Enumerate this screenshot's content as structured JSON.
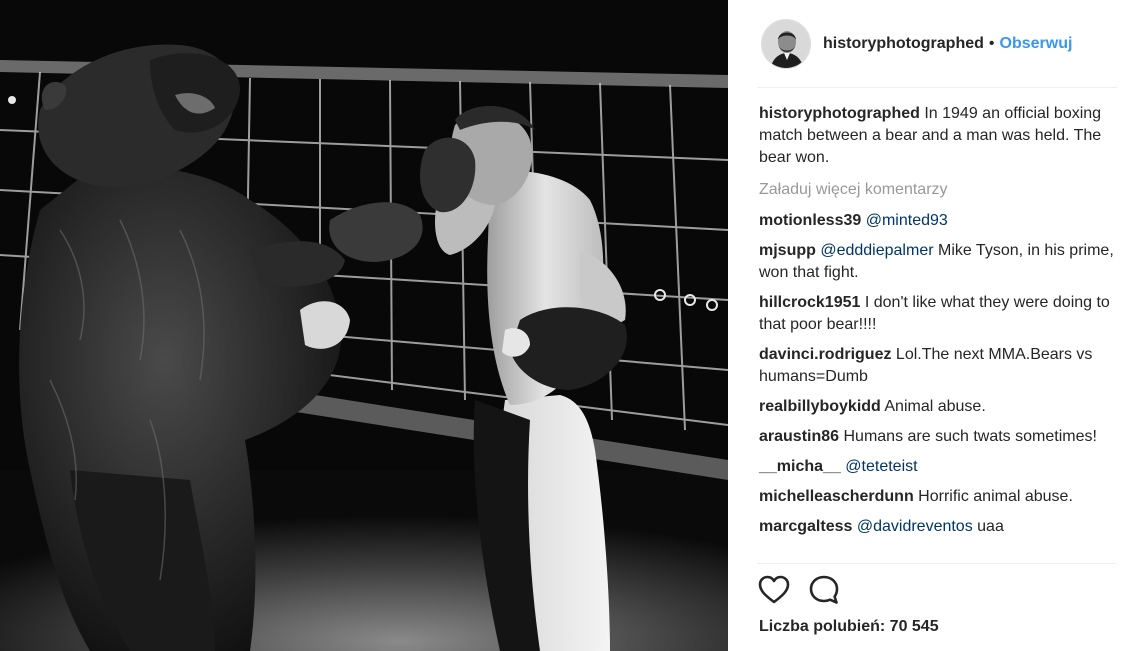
{
  "post": {
    "author": "historyphotographed",
    "separator": "•",
    "follow_label": "Obserwuj",
    "caption_author": "historyphotographed",
    "caption_text": " In 1949 an official boxing match between a bear and a man was held. The bear won.",
    "load_more_label": "Załaduj więcej komentarzy",
    "likes_text": "Liczba polubień: 70 545"
  },
  "comments": [
    {
      "user": "motionless39",
      "mention": "@minted93",
      "text": ""
    },
    {
      "user": "mjsupp",
      "mention": "@edddiepalmer",
      "text": " Mike Tyson, in his prime, won that fight."
    },
    {
      "user": "hillcrock1951",
      "mention": "",
      "text": " I don't like what they were doing to that poor bear!!!!"
    },
    {
      "user": "davinci.rodriguez",
      "mention": "",
      "text": " Lol.The next MMA.Bears vs humans=Dumb"
    },
    {
      "user": "realbillyboykidd",
      "mention": "",
      "text": " Animal abuse."
    },
    {
      "user": "araustin86",
      "mention": "",
      "text": " Humans are such twats sometimes!"
    },
    {
      "user": "__micha__",
      "mention": "@teteteist",
      "text": ""
    },
    {
      "user": "michelleascherdunn",
      "mention": "",
      "text": " Horrific animal abuse."
    },
    {
      "user": "marcgaltess",
      "mention": "@davidreventos",
      "text": " uaa"
    }
  ],
  "icons": {
    "like": "heart-icon",
    "comment": "speech-bubble-icon"
  },
  "colors": {
    "link": "#3897f0",
    "mention": "#003569",
    "muted": "#999999",
    "text": "#262626"
  }
}
